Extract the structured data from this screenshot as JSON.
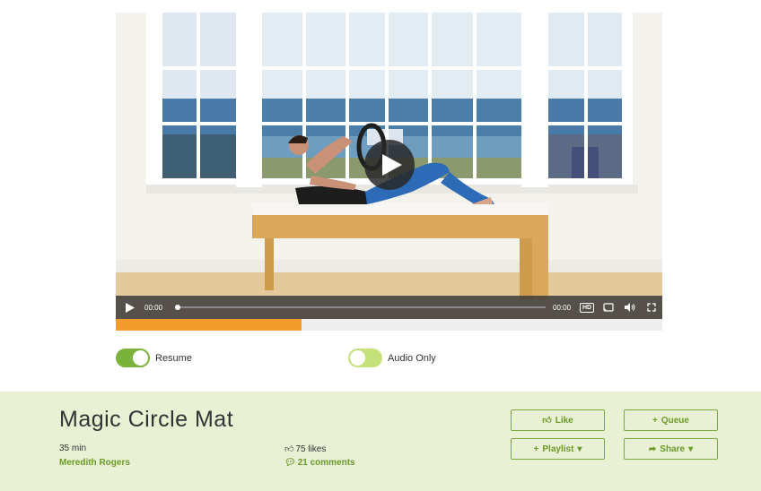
{
  "player": {
    "current_time": "00:00",
    "duration_time": "00:00",
    "hd_label": "HD",
    "watched_fraction": 0.34
  },
  "toggles": [
    {
      "label": "Resume",
      "on": true
    },
    {
      "label": "Audio Only",
      "on": false
    }
  ],
  "video": {
    "title": "Magic Circle Mat",
    "duration": "35 min",
    "instructor": "Meredith Rogers",
    "likes": "75 likes",
    "comments": "21 comments"
  },
  "actions": {
    "like": "Like",
    "queue": "Queue",
    "playlist": "Playlist",
    "share": "Share"
  },
  "colors": {
    "accent_green": "#6c9a2a",
    "panel_bg": "#e8f1d3",
    "progress_orange": "#f39b2b",
    "toggle_on": "#7ab23c",
    "toggle_off": "#c6e07a"
  }
}
